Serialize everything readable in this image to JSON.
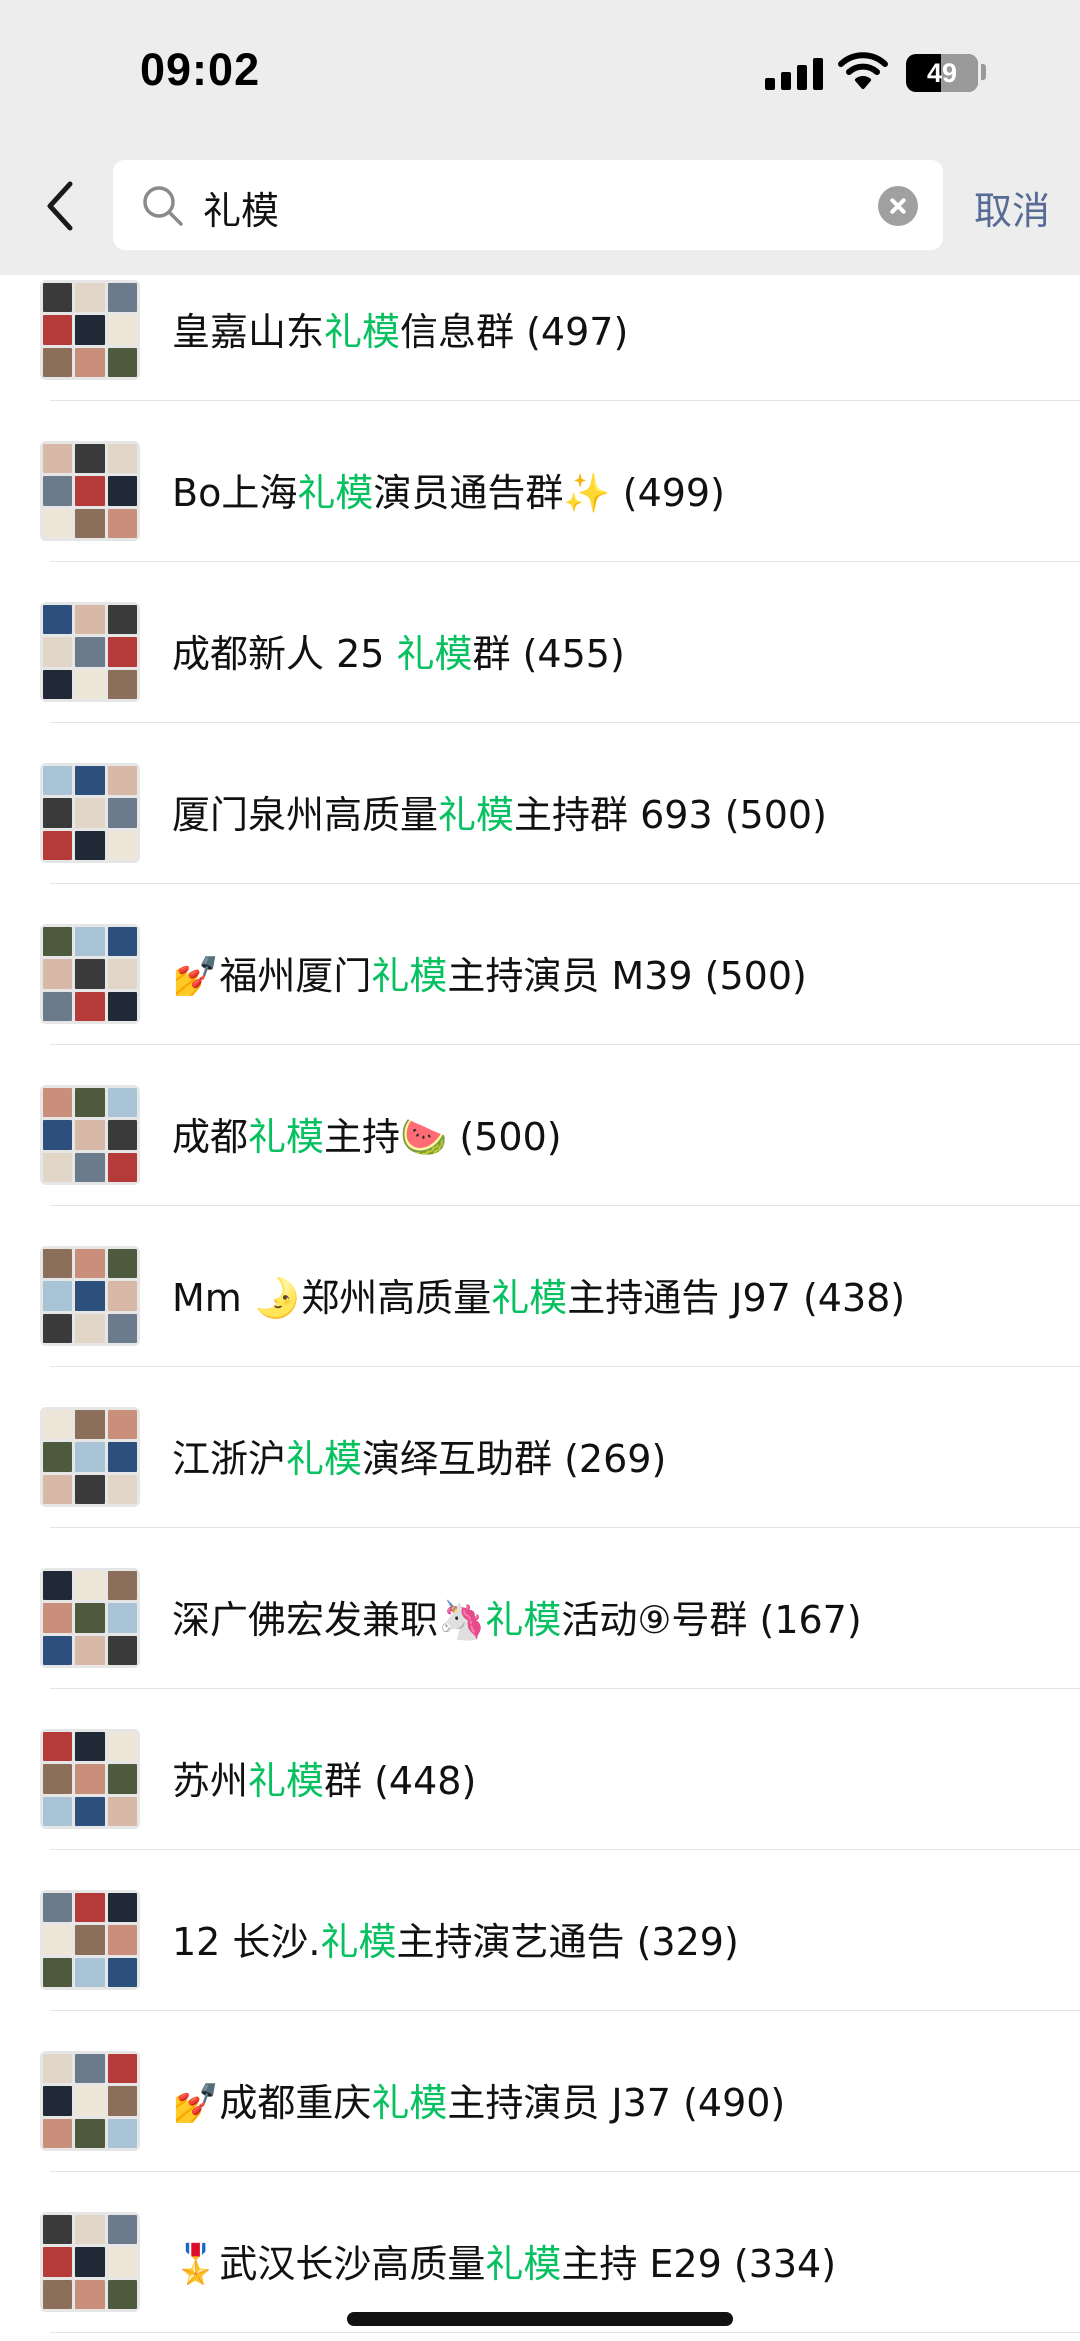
{
  "status_bar": {
    "time": "09:02",
    "battery_level": "49",
    "icons": [
      "signal-icon",
      "wifi-icon",
      "battery-icon"
    ]
  },
  "search": {
    "query": "礼模",
    "cancel_label": "取消"
  },
  "colors": {
    "highlight": "#07c160",
    "cancel_link": "#576b95",
    "header_bg": "#ededed"
  },
  "results": [
    {
      "before": "皇嘉山东",
      "match": "礼模",
      "after": "信息群 (497)"
    },
    {
      "before": "Bo上海",
      "match": "礼模",
      "after": "演员通告群✨ (499)"
    },
    {
      "before": "成都新人 25 ",
      "match": "礼模",
      "after": "群 (455)"
    },
    {
      "before": "厦门泉州高质量",
      "match": "礼模",
      "after": "主持群 693 (500)"
    },
    {
      "before": "💅福州厦门",
      "match": "礼模",
      "after": "主持演员 M39 (500)"
    },
    {
      "before": "成都",
      "match": "礼模",
      "after": "主持🍉 (500)"
    },
    {
      "before": "Mm 🌛郑州高质量",
      "match": "礼模",
      "after": "主持通告 J97 (438)"
    },
    {
      "before": "江浙沪",
      "match": "礼模",
      "after": "演绎互助群 (269)"
    },
    {
      "before": "深广佛宏发兼职🦄",
      "match": "礼模",
      "after": "活动⑨号群 (167)"
    },
    {
      "before": "苏州",
      "match": "礼模",
      "after": "群 (448)"
    },
    {
      "before": "12 长沙.",
      "match": "礼模",
      "after": "主持演艺通告 (329)"
    },
    {
      "before": "💅成都重庆",
      "match": "礼模",
      "after": "主持演员 J37 (490)"
    },
    {
      "before": "🎖️武汉长沙高质量",
      "match": "礼模",
      "after": "主持 E29 (334)"
    }
  ]
}
